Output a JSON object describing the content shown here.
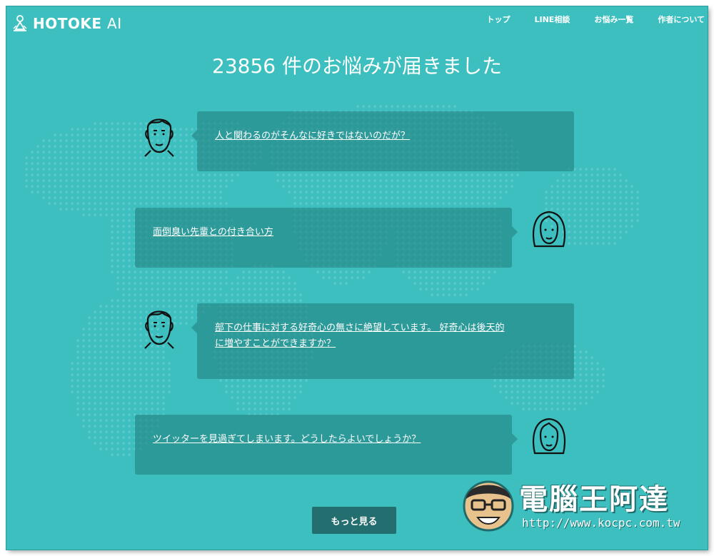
{
  "brand": {
    "name": "HOTOKE",
    "suffix": "AI"
  },
  "nav": [
    {
      "label": "トップ"
    },
    {
      "label": "LINE相談"
    },
    {
      "label": "お悩み一覧"
    },
    {
      "label": "作者について"
    }
  ],
  "headline": "23856 件のお悩みが届きました",
  "worries": [
    {
      "text": "人と関わるのがそんなに好きではないのだが？",
      "avatar": "man-icon"
    },
    {
      "text": "面倒臭い先輩との付き合い方",
      "avatar": "woman-icon"
    },
    {
      "line1": "部下の仕事に対する好奇心の無さに絶望しています。 好奇心は後天的",
      "line2": "に増やすことができますか？",
      "avatar": "man-icon"
    },
    {
      "text": "ツイッターを見過ぎてしまいます。どうしたらよいでしょうか？",
      "avatar": "woman-icon"
    }
  ],
  "more_button": "もっと見る",
  "watermark": {
    "title": "電腦王阿達",
    "url": "http://www.kocpc.com.tw"
  },
  "colors": {
    "background": "#3dbfbf",
    "bubble": "#238282",
    "button": "#236e6e",
    "text": "#ffffff"
  }
}
